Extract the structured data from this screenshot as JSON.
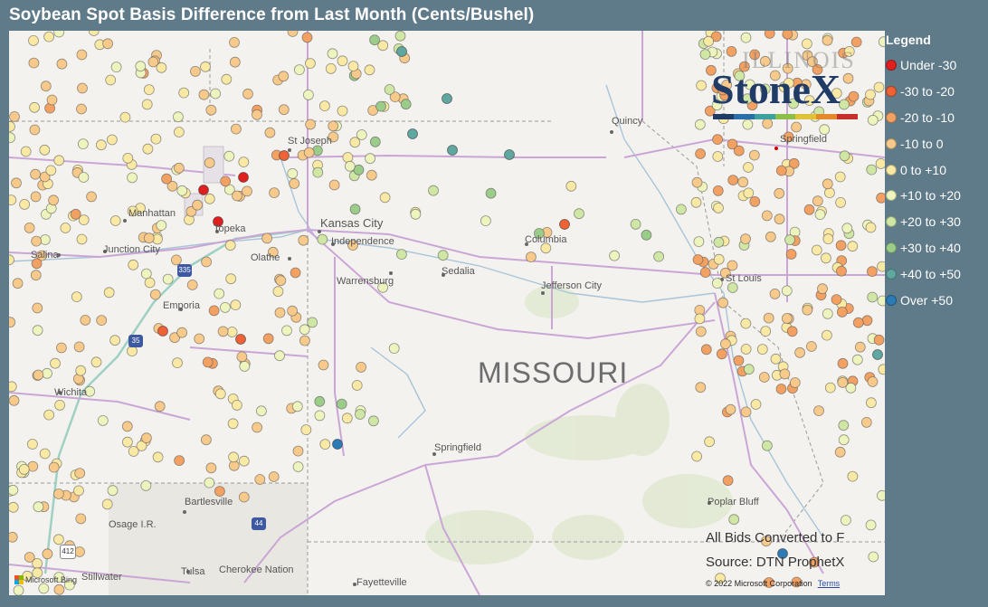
{
  "title": "Soybean Spot Basis Difference from Last Month (Cents/Bushel)",
  "legend": {
    "title": "Legend",
    "items": [
      {
        "label": "Under -30",
        "color": "#e01f1f"
      },
      {
        "label": "-30 to -20",
        "color": "#ee6236"
      },
      {
        "label": "-20 to -10",
        "color": "#f3a163"
      },
      {
        "label": "-10 to 0",
        "color": "#f7c98a"
      },
      {
        "label": "0 to +10",
        "color": "#f9e9a4"
      },
      {
        "label": "+10 to +20",
        "color": "#eef4bd"
      },
      {
        "label": "+20 to +30",
        "color": "#cfe6a4"
      },
      {
        "label": "+30 to +40",
        "color": "#9ccc8a"
      },
      {
        "label": "+40 to +50",
        "color": "#5fa7a0"
      },
      {
        "label": "Over +50",
        "color": "#2c7bb6"
      }
    ]
  },
  "logo": {
    "wordmark": "StoneX",
    "ghost_text": "ILLINOIS"
  },
  "notes": {
    "converted": "All Bids Converted to F",
    "source": "Source: DTN ProphetX"
  },
  "attribution": {
    "bing": "Microsoft Bing",
    "copyright": "© 2022 Microsoft Corporation",
    "terms": "Terms"
  },
  "map": {
    "state_label": "MISSOURI",
    "cities": [
      {
        "name": "St Joseph"
      },
      {
        "name": "Manhattan"
      },
      {
        "name": "Topeka"
      },
      {
        "name": "Junction City"
      },
      {
        "name": "Salina"
      },
      {
        "name": "Kansas City"
      },
      {
        "name": "Independence"
      },
      {
        "name": "Olathe"
      },
      {
        "name": "Emporia"
      },
      {
        "name": "Wichita"
      },
      {
        "name": "Warrensburg"
      },
      {
        "name": "Sedalia"
      },
      {
        "name": "Columbia"
      },
      {
        "name": "Jefferson City"
      },
      {
        "name": "St Louis"
      },
      {
        "name": "Quincy"
      },
      {
        "name": "Springfield"
      },
      {
        "name": "Springfield"
      },
      {
        "name": "Bartlesville"
      },
      {
        "name": "Osage I.R."
      },
      {
        "name": "Tulsa"
      },
      {
        "name": "Cherokee Nation"
      },
      {
        "name": "Stillwater"
      },
      {
        "name": "Fayetteville"
      },
      {
        "name": "Poplar Bluff"
      }
    ],
    "highway_shields": [
      {
        "label": "335"
      },
      {
        "label": "35"
      },
      {
        "label": "44"
      },
      {
        "label": "412"
      }
    ]
  }
}
